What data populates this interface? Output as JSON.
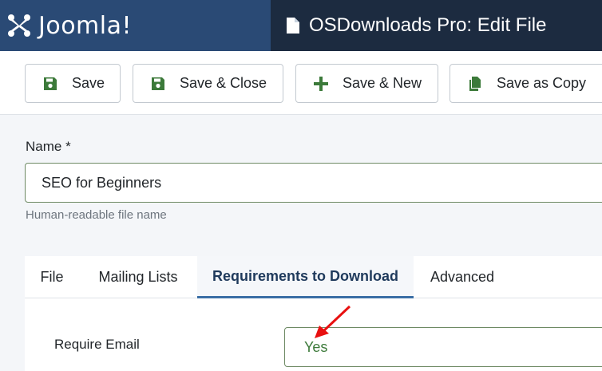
{
  "header": {
    "brand": "Joomla!",
    "page_title": "OSDownloads Pro: Edit File"
  },
  "toolbar": {
    "save_label": "Save",
    "save_close_label": "Save & Close",
    "save_new_label": "Save & New",
    "save_copy_label": "Save as Copy"
  },
  "form": {
    "name_label": "Name *",
    "name_value": "SEO for Beginners",
    "name_help": "Human-readable file name"
  },
  "tabs": [
    {
      "label": "File",
      "active": false
    },
    {
      "label": "Mailing Lists",
      "active": false
    },
    {
      "label": "Requirements to Download",
      "active": true
    },
    {
      "label": "Advanced",
      "active": false
    }
  ],
  "requirements": {
    "require_email_label": "Require Email",
    "require_email_value": "Yes"
  },
  "colors": {
    "brand_bg": "#2a4a75",
    "title_bg": "#1c2b40",
    "save_icon": "#3c7a3a",
    "arrow": "#e81010"
  },
  "icons": [
    "joomla-logo-icon",
    "file-icon",
    "floppy-disk-icon",
    "plus-icon",
    "copy-icon",
    "red-arrow-annotation"
  ]
}
